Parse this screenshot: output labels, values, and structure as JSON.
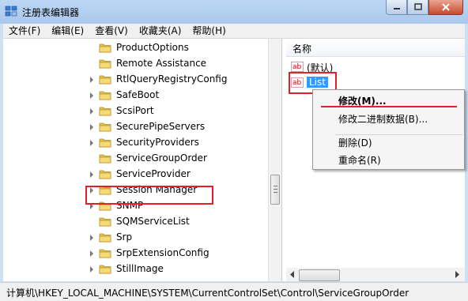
{
  "window": {
    "title": "注册表编辑器",
    "controls": {
      "minimize": "minimize",
      "maximize": "maximize",
      "close": "close"
    }
  },
  "menubar": {
    "items": [
      "文件(F)",
      "编辑(E)",
      "查看(V)",
      "收藏夹(A)",
      "帮助(H)"
    ]
  },
  "tree": {
    "items": [
      {
        "label": "ProductOptions",
        "expandable": false
      },
      {
        "label": "Remote Assistance",
        "expandable": false
      },
      {
        "label": "RtlQueryRegistryConfig",
        "expandable": true
      },
      {
        "label": "SafeBoot",
        "expandable": true
      },
      {
        "label": "ScsiPort",
        "expandable": true
      },
      {
        "label": "SecurePipeServers",
        "expandable": true
      },
      {
        "label": "SecurityProviders",
        "expandable": true
      },
      {
        "label": "ServiceGroupOrder",
        "expandable": false,
        "highlighted": true
      },
      {
        "label": "ServiceProvider",
        "expandable": true
      },
      {
        "label": "Session Manager",
        "expandable": true
      },
      {
        "label": "SNMP",
        "expandable": true
      },
      {
        "label": "SQMServiceList",
        "expandable": false
      },
      {
        "label": "Srp",
        "expandable": true
      },
      {
        "label": "SrpExtensionConfig",
        "expandable": true
      },
      {
        "label": "StillImage",
        "expandable": true
      }
    ]
  },
  "list": {
    "header_name": "名称",
    "values": [
      {
        "icon": "ab",
        "name": "(默认)"
      },
      {
        "icon": "ab",
        "name": "List",
        "selected": true
      }
    ]
  },
  "context_menu": {
    "items": [
      "修改(M)...",
      "修改二进制数据(B)...",
      "删除(D)",
      "重命名(R)"
    ]
  },
  "statusbar": {
    "path": "计算机\\HKEY_LOCAL_MACHINE\\SYSTEM\\CurrentControlSet\\Control\\ServiceGroupOrder"
  },
  "colors": {
    "highlight_box": "#e0202a",
    "selection": "#3399ff",
    "folder": "#e8c44a"
  }
}
